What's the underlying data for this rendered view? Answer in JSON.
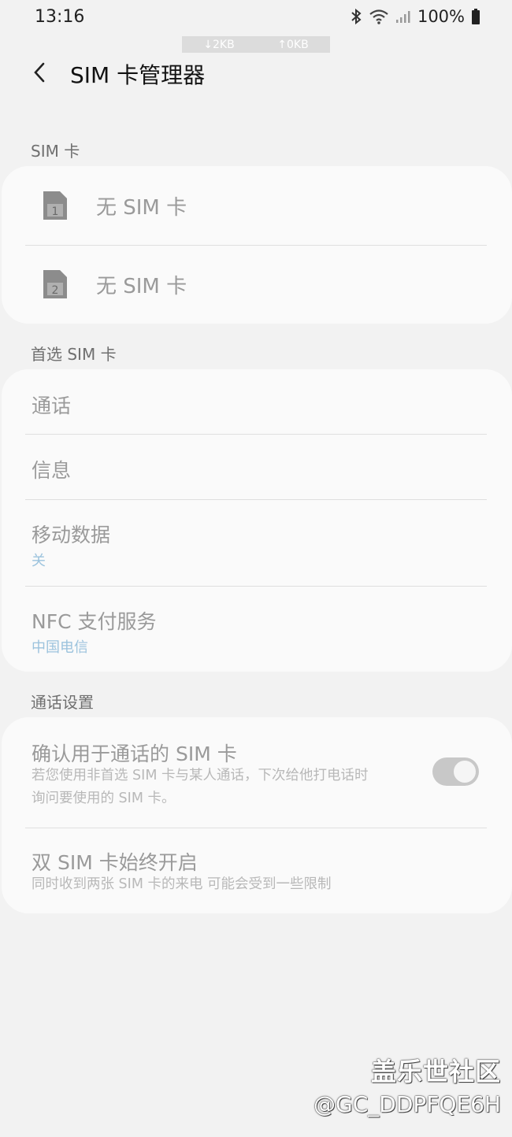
{
  "status": {
    "time": "13:16",
    "battery": "100%",
    "down": "↓2KB",
    "up": "↑0KB"
  },
  "header": {
    "title": "SIM 卡管理器"
  },
  "sections": {
    "sim_cards": "SIM 卡",
    "preferred": "首选 SIM 卡",
    "call_settings": "通话设置"
  },
  "sims": [
    {
      "slot": "1",
      "label": "无 SIM 卡"
    },
    {
      "slot": "2",
      "label": "无 SIM 卡"
    }
  ],
  "preferred": {
    "calls": "通话",
    "messages": "信息",
    "mobile_data": "移动数据",
    "mobile_data_value": "关",
    "nfc": "NFC 支付服务",
    "nfc_value": "中国电信"
  },
  "call_settings": {
    "confirm_title": "确认用于通话的 SIM 卡",
    "confirm_desc_line1": "若您使用非首选 SIM 卡与某人通话，下次给他打电话时",
    "confirm_desc_line2": "询问要使用的 SIM 卡。",
    "confirm_enabled": true,
    "dual_title": "双 SIM 卡始终开启",
    "dual_desc": "同时收到两张 SIM 卡的来电 可能会受到一些限制"
  },
  "watermark": {
    "line1": "盖乐世社区",
    "line2": "@GC_DDPFQE6H"
  },
  "colors": {
    "background": "#f2f2f2",
    "card": "#fafafa",
    "accent_sub": "#9cc3dd"
  }
}
